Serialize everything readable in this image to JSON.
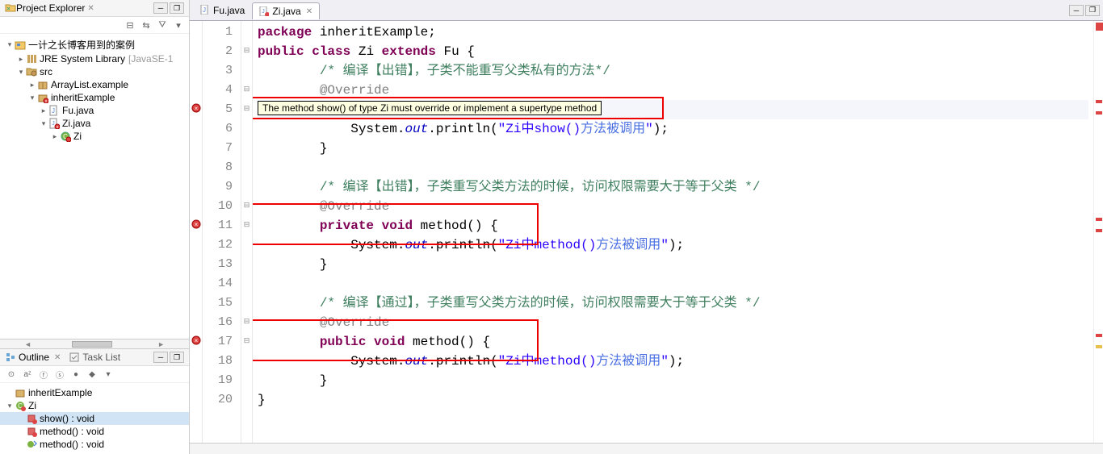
{
  "explorer": {
    "title": "Project Explorer",
    "project": "一计之长博客用到的案例",
    "jre": "JRE System Library",
    "jre_suffix": "[JavaSE-1",
    "src": "src",
    "pkg1": "ArrayList.example",
    "pkg2": "inheritExample",
    "file1": "Fu.java",
    "file2": "Zi.java",
    "cls": "Zi"
  },
  "outline": {
    "title": "Outline",
    "tasklist": "Task List",
    "pkg": "inheritExample",
    "cls": "Zi",
    "m1": "show() : void",
    "m2": "method() : void",
    "m3": "method() : void"
  },
  "tabs": {
    "t1": "Fu.java",
    "t2": "Zi.java"
  },
  "tooltip": "The method show() of type Zi must override or implement a supertype method",
  "code": {
    "l1_a": "package",
    "l1_b": " inheritExample;",
    "l2_a": "public",
    "l2_b": "class",
    "l2_c": " Zi ",
    "l2_d": "extends",
    "l2_e": " Fu {",
    "l3": "/* 编译【出错】，子类不能重写父类私有的方法*/",
    "l4": "@Override",
    "l6_a": "            System.",
    "l6_b": "out",
    "l6_c": ".println(",
    "l6_d": "\"Zi中show()",
    "l6_e": "方法被调用",
    "l6_f": "\"",
    "l6_g": ");",
    "l7": "        }",
    "l9": "/* 编译【出错】，子类重写父类方法的时候，访问权限需要大于等于父类 */",
    "l10": "@Override",
    "l11_a": "private",
    "l11_b": "void",
    "l11_c": " method() {",
    "l12_a": "            System.",
    "l12_b": "out",
    "l12_c": ".println(",
    "l12_d": "\"Zi中method()",
    "l12_e": "方法被调用",
    "l12_f": "\"",
    "l12_g": ");",
    "l13": "        }",
    "l15": "/* 编译【通过】，子类重写父类方法的时候，访问权限需要大于等于父类 */",
    "l16": "@Override",
    "l17_a": "public",
    "l17_b": "void",
    "l17_c": " method() {",
    "l18_a": "            System.",
    "l18_b": "out",
    "l18_c": ".println(",
    "l18_d": "\"Zi中method()",
    "l18_e": "方法被调用",
    "l18_f": "\"",
    "l18_g": ");",
    "l19": "        }",
    "l20": "}"
  }
}
